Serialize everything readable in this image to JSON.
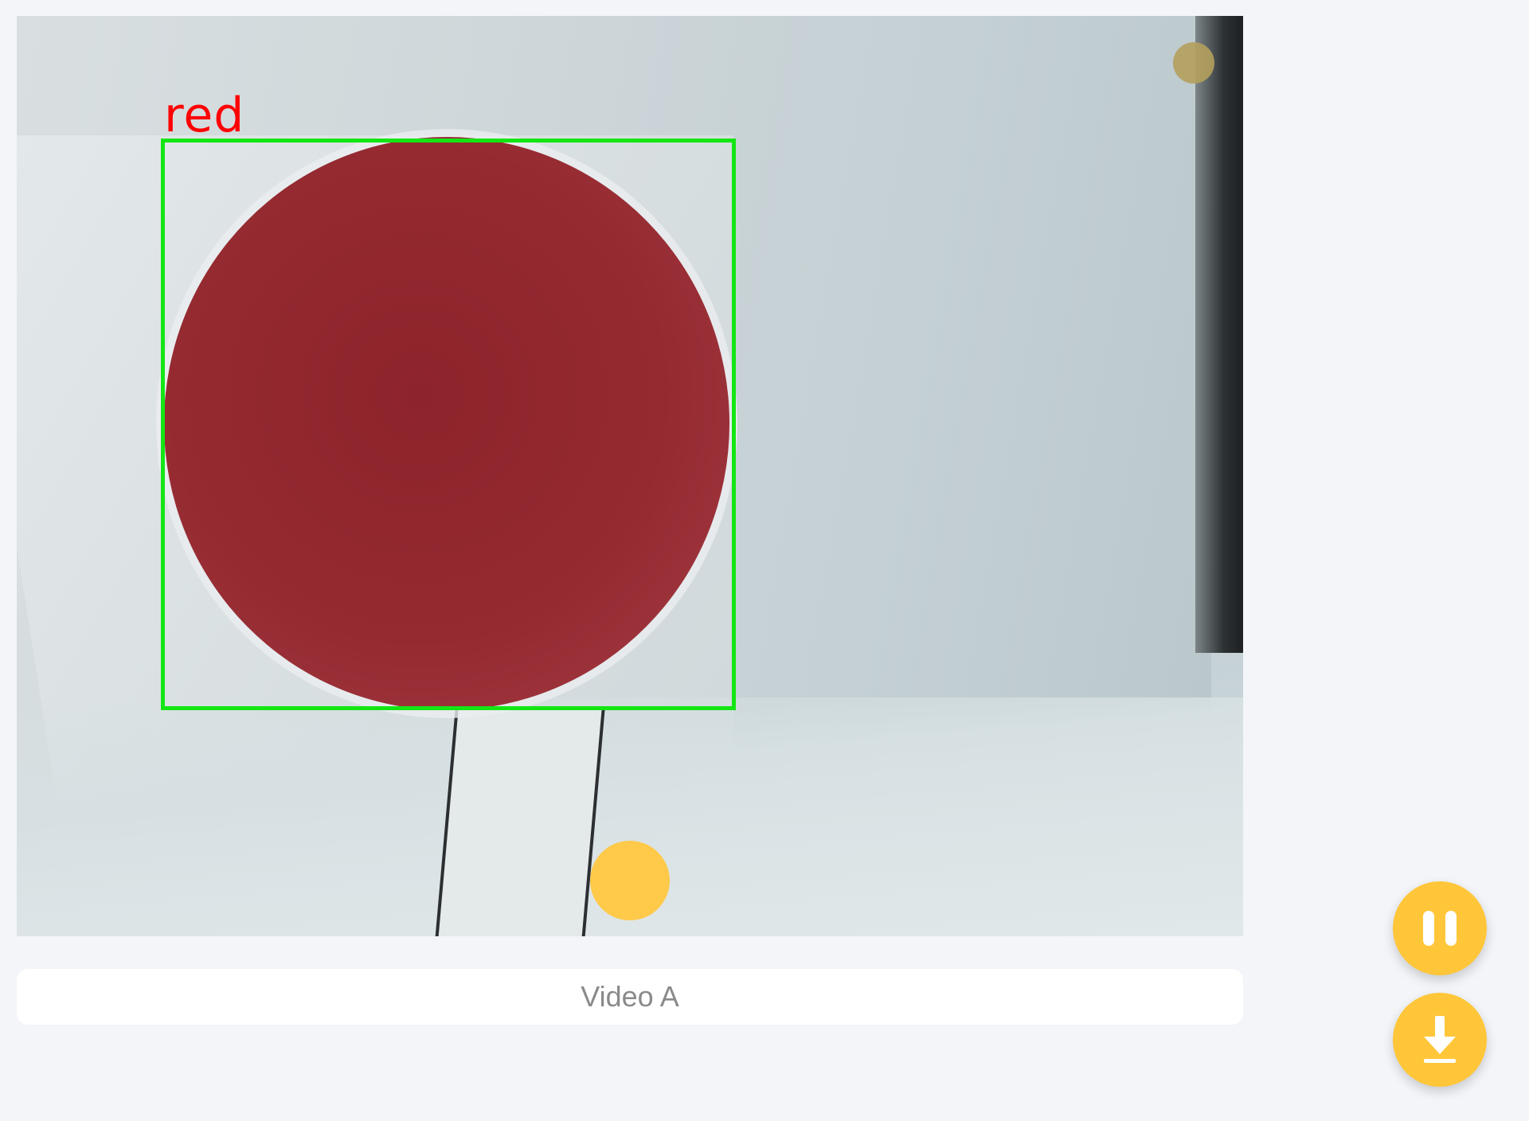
{
  "video": {
    "detection_label": "red",
    "detection_color": "#ff0000",
    "bbox_color": "#14e614"
  },
  "caption": {
    "text": "Video A"
  },
  "controls": {
    "accent_color": "#ffc63a",
    "pause_icon": "pause-icon",
    "download_icon": "download-icon"
  }
}
